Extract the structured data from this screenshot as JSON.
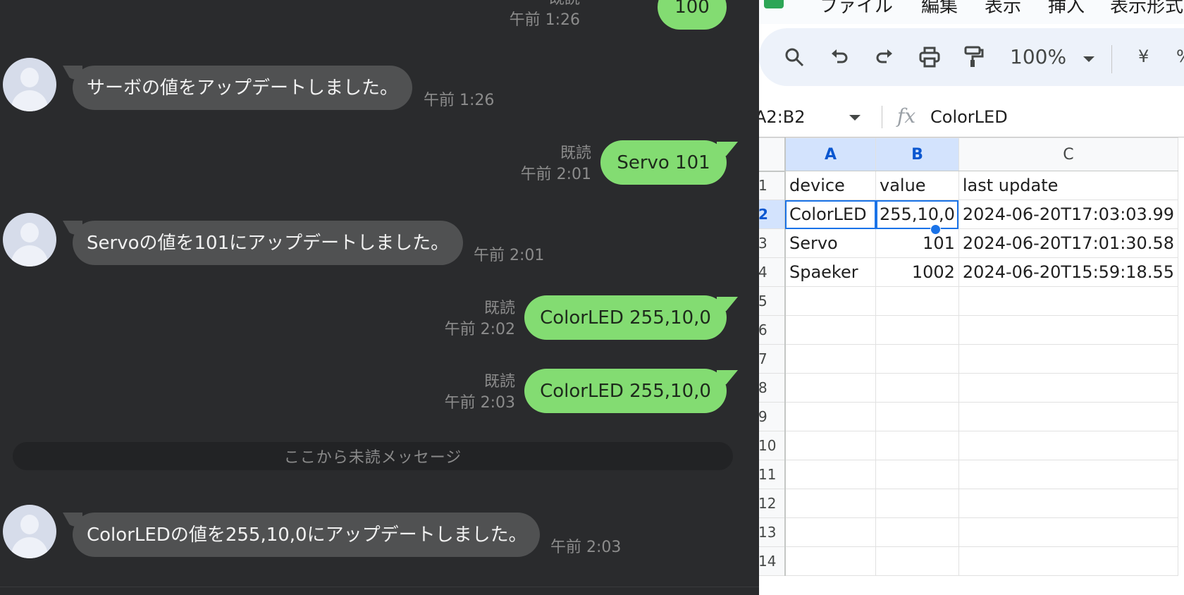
{
  "chat": {
    "messages": [
      {
        "dir": "out",
        "text": "100",
        "read": "既読",
        "time": "午前 1:26"
      },
      {
        "dir": "in",
        "text": "サーボの値をアップデートしました。",
        "time": "午前 1:26"
      },
      {
        "dir": "out",
        "text": "Servo 101",
        "read": "既読",
        "time": "午前 2:01"
      },
      {
        "dir": "in",
        "text": "Servoの値を101にアップデートしました。",
        "time": "午前 2:01"
      },
      {
        "dir": "out",
        "text": "ColorLED 255,10,0",
        "read": "既読",
        "time": "午前 2:02"
      },
      {
        "dir": "out",
        "text": "ColorLED 255,10,0",
        "read": "既読",
        "time": "午前 2:03"
      },
      {
        "dir": "in",
        "text": "ColorLEDの値を255,10,0にアップデートしました。",
        "time": "午前 2:03"
      }
    ],
    "unread_divider": "ここから未読メッセージ"
  },
  "sheet": {
    "menu": [
      "ファイル",
      "編集",
      "表示",
      "挿入",
      "表示形式"
    ],
    "toolbar": {
      "icons": [
        "search-icon",
        "undo-icon",
        "redo-icon",
        "print-icon",
        "paint-format-icon"
      ],
      "zoom": "100%",
      "currency": "¥",
      "percent": "%"
    },
    "name_box": "A2:B2",
    "fx": "fx",
    "formula_value": "ColorLED",
    "columns": [
      "A",
      "B",
      "C"
    ],
    "rows": [
      {
        "n": "1",
        "cells": [
          "device",
          "value",
          "last update"
        ]
      },
      {
        "n": "2",
        "cells": [
          "ColorLED",
          "255,10,0",
          "2024-06-20T17:03:03.99"
        ]
      },
      {
        "n": "3",
        "cells": [
          "Servo",
          "101",
          "2024-06-20T17:01:30.58"
        ]
      },
      {
        "n": "4",
        "cells": [
          "Spaeker",
          "1002",
          "2024-06-20T15:59:18.55"
        ]
      },
      {
        "n": "5",
        "cells": [
          "",
          "",
          ""
        ]
      },
      {
        "n": "6",
        "cells": [
          "",
          "",
          ""
        ]
      },
      {
        "n": "7",
        "cells": [
          "",
          "",
          ""
        ]
      },
      {
        "n": "8",
        "cells": [
          "",
          "",
          ""
        ]
      },
      {
        "n": "9",
        "cells": [
          "",
          "",
          ""
        ]
      },
      {
        "n": "10",
        "cells": [
          "",
          "",
          ""
        ]
      },
      {
        "n": "11",
        "cells": [
          "",
          "",
          ""
        ]
      },
      {
        "n": "12",
        "cells": [
          "",
          "",
          ""
        ]
      },
      {
        "n": "13",
        "cells": [
          "",
          "",
          ""
        ]
      },
      {
        "n": "14",
        "cells": [
          "",
          "",
          ""
        ]
      }
    ]
  }
}
